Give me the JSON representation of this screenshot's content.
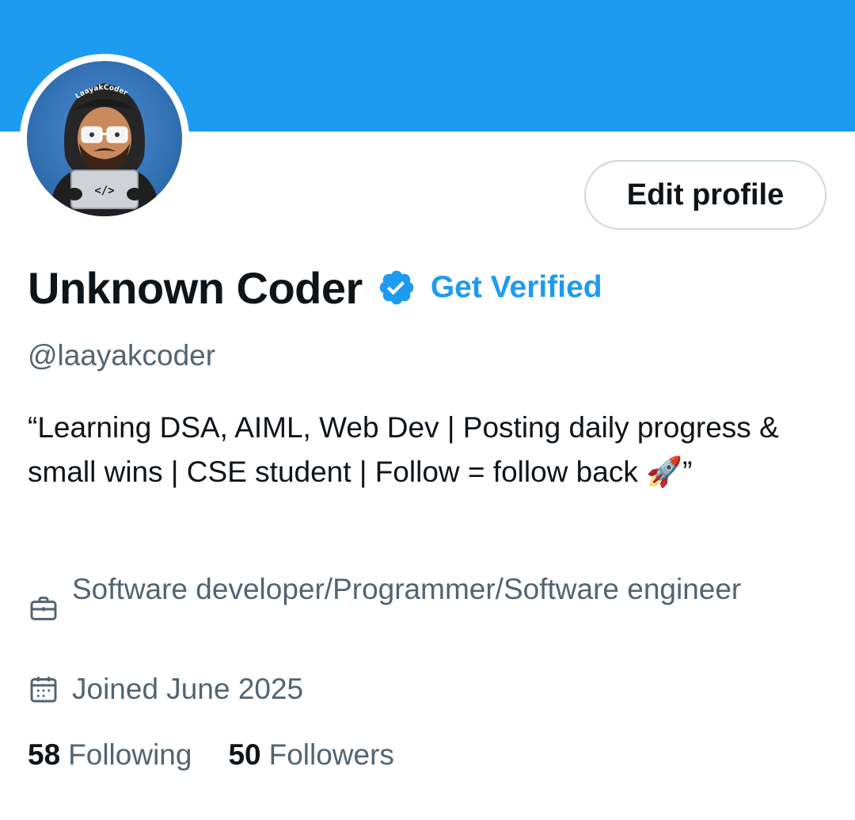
{
  "profile": {
    "display_name": "Unknown Coder",
    "get_verified_label": "Get Verified",
    "handle": "@laayakcoder",
    "bio": "“Learning DSA, AIML, Web Dev | Posting daily progress & small wins | CSE student | Follow = follow back 🚀”",
    "profession": "Software developer/Programmer/Software engineer",
    "joined": "Joined June 2025",
    "edit_profile_label": "Edit profile",
    "avatar_cap_text": "LaayakCoder",
    "avatar_laptop_text": "</>"
  },
  "stats": {
    "following_count": "58",
    "following_label": "Following",
    "followers_count": "50",
    "followers_label": "Followers"
  },
  "colors": {
    "banner": "#1d9bf0",
    "accent": "#1d9bf0",
    "primary_text": "#0f1419",
    "secondary_text": "#536471",
    "button_border": "#cfd9de"
  },
  "icons": {
    "verified": "verified-badge-icon",
    "profession": "briefcase-icon",
    "joined": "calendar-icon"
  }
}
